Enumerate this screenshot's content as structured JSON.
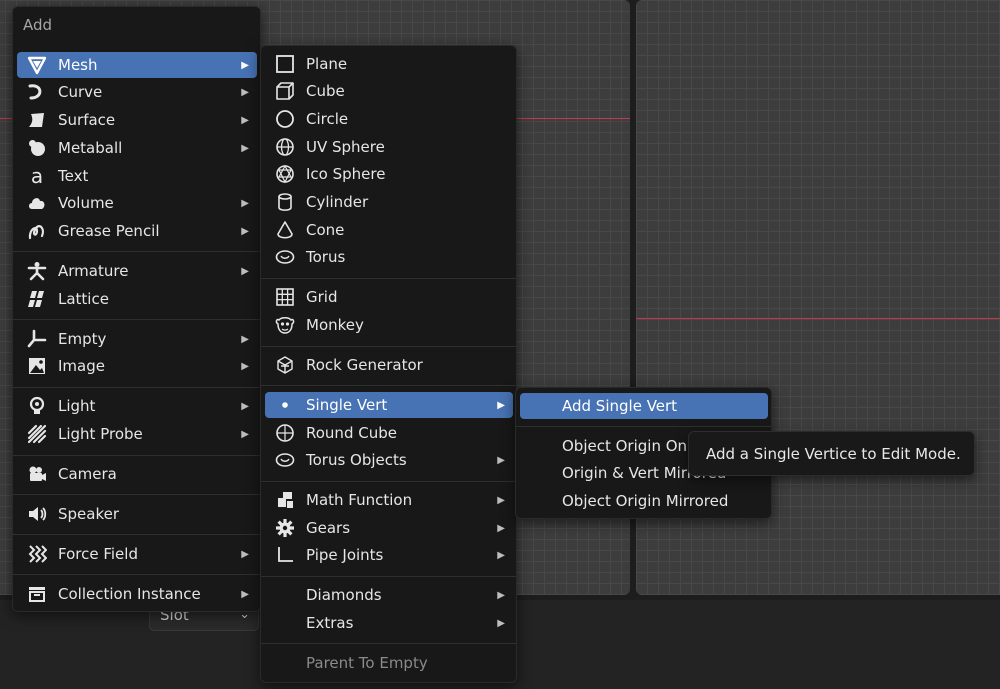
{
  "bottom": {
    "slot_value": "Slot"
  },
  "add_menu": {
    "title": "Add",
    "items": [
      {
        "label": "Mesh",
        "icon": "mesh-icon"
      },
      {
        "label": "Curve",
        "icon": "curve-icon"
      },
      {
        "label": "Surface",
        "icon": "surface-icon"
      },
      {
        "label": "Metaball",
        "icon": "metaball-icon"
      },
      {
        "label": "Text",
        "icon": "text-icon"
      },
      {
        "label": "Volume",
        "icon": "volume-icon"
      },
      {
        "label": "Grease Pencil",
        "icon": "grease-pencil-icon"
      },
      {
        "label": "Armature",
        "icon": "armature-icon"
      },
      {
        "label": "Lattice",
        "icon": "lattice-icon"
      },
      {
        "label": "Empty",
        "icon": "empty-icon"
      },
      {
        "label": "Image",
        "icon": "image-icon"
      },
      {
        "label": "Light",
        "icon": "light-icon"
      },
      {
        "label": "Light Probe",
        "icon": "light-probe-icon"
      },
      {
        "label": "Camera",
        "icon": "camera-icon"
      },
      {
        "label": "Speaker",
        "icon": "speaker-icon"
      },
      {
        "label": "Force Field",
        "icon": "force-field-icon"
      },
      {
        "label": "Collection Instance",
        "icon": "collection-instance-icon"
      }
    ]
  },
  "mesh_menu": {
    "items": [
      {
        "label": "Plane",
        "icon": "plane-icon"
      },
      {
        "label": "Cube",
        "icon": "cube-icon"
      },
      {
        "label": "Circle",
        "icon": "circle-icon"
      },
      {
        "label": "UV Sphere",
        "icon": "uv-sphere-icon"
      },
      {
        "label": "Ico Sphere",
        "icon": "ico-sphere-icon"
      },
      {
        "label": "Cylinder",
        "icon": "cylinder-icon"
      },
      {
        "label": "Cone",
        "icon": "cone-icon"
      },
      {
        "label": "Torus",
        "icon": "torus-icon"
      },
      {
        "label": "Grid",
        "icon": "grid-icon"
      },
      {
        "label": "Monkey",
        "icon": "monkey-icon"
      },
      {
        "label": "Rock Generator",
        "icon": "rock-generator-icon"
      },
      {
        "label": "Single Vert",
        "icon": "vertex-dot-icon"
      },
      {
        "label": "Round Cube",
        "icon": "round-cube-icon"
      },
      {
        "label": "Torus Objects",
        "icon": "torus-objects-icon"
      },
      {
        "label": "Math Function",
        "icon": "math-function-icon"
      },
      {
        "label": "Gears",
        "icon": "gears-icon"
      },
      {
        "label": "Pipe Joints",
        "icon": "pipe-joints-icon"
      },
      {
        "label": "Diamonds",
        "icon": ""
      },
      {
        "label": "Extras",
        "icon": ""
      },
      {
        "label": "Parent To Empty",
        "icon": ""
      }
    ]
  },
  "single_vert_menu": {
    "items": [
      {
        "label": "Add Single Vert"
      },
      {
        "label": "Object Origin Only"
      },
      {
        "label": "Origin & Vert Mirrored"
      },
      {
        "label": "Object Origin Mirrored"
      }
    ]
  },
  "tooltip": {
    "text": "Add a Single Vertice to Edit Mode."
  },
  "colors": {
    "highlight": "#4772b3",
    "menu_bg": "#181818",
    "axis_red": "#c1394a",
    "viewport_bg": "#3d3d3d"
  }
}
